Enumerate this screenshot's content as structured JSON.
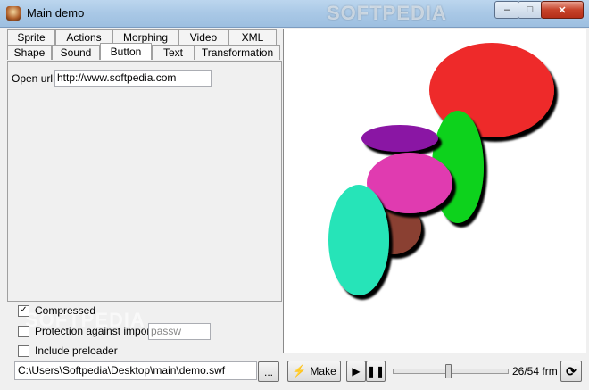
{
  "window": {
    "title": "Main demo",
    "watermark": "SOFTPEDIA",
    "controls": {
      "minimize": "–",
      "maximize": "□",
      "close": "✕"
    }
  },
  "tabs": {
    "back_row": [
      "Sprite",
      "Actions",
      "Morphing",
      "Video",
      "XML"
    ],
    "front_row": [
      "Shape",
      "Sound",
      "Button",
      "Text",
      "Transformation"
    ],
    "active": "Button"
  },
  "button_panel": {
    "open_url_label": "Open url:",
    "open_url_value": "http://www.softpedia.com"
  },
  "options": {
    "compressed": {
      "label": "Compressed",
      "checked": true
    },
    "protection": {
      "label": "Protection against import",
      "checked": false,
      "password_placeholder": "passw"
    },
    "preloader": {
      "label": "Include preloader",
      "checked": false
    },
    "watermark": "SOFTPEDIA"
  },
  "output": {
    "path": "C:\\Users\\Softpedia\\Desktop\\main\\demo.swf",
    "browse_label": "..."
  },
  "player": {
    "make_label": "Make",
    "play_icon": "play-icon",
    "pause_icon": "pause-icon",
    "loop_icon": "loop-icon",
    "frame_text": "26/54 frm",
    "current_frame": 26,
    "total_frames": 54
  },
  "shapes": [
    {
      "name": "red-ellipse",
      "color": "#ee2a2a"
    },
    {
      "name": "green-ellipse",
      "color": "#0bd21e"
    },
    {
      "name": "purple-ellipse",
      "color": "#8a12a4"
    },
    {
      "name": "magenta-ellipse",
      "color": "#e03ab0"
    },
    {
      "name": "brown-ellipse",
      "color": "#8a4030"
    },
    {
      "name": "teal-ellipse",
      "color": "#28e4b8"
    }
  ]
}
